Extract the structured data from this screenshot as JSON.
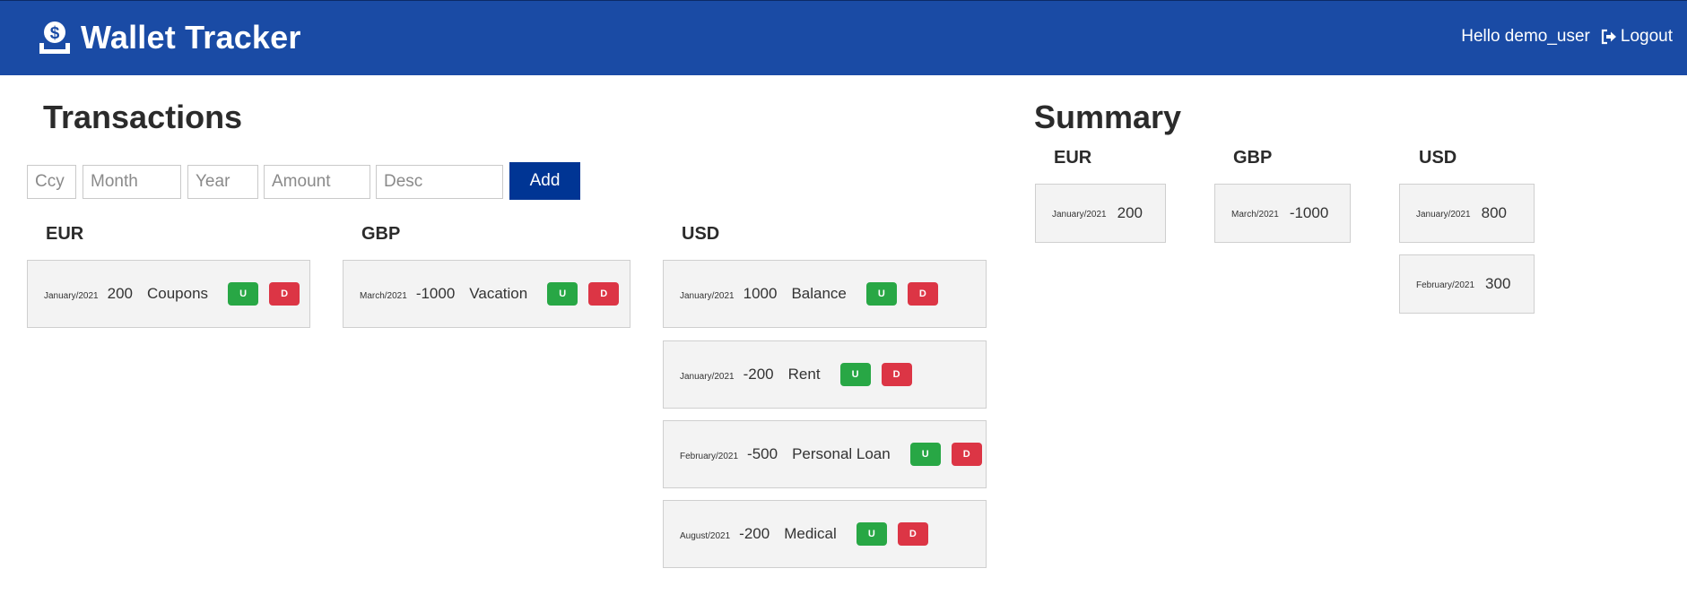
{
  "header": {
    "title": "Wallet Tracker",
    "greeting": "Hello demo_user",
    "logout_label": "Logout",
    "bg_color": "#1a4ba5"
  },
  "transactions": {
    "title": "Transactions",
    "form": {
      "ccy_placeholder": "Ccy",
      "month_placeholder": "Month",
      "year_placeholder": "Year",
      "amount_placeholder": "Amount",
      "desc_placeholder": "Desc",
      "add_label": "Add"
    },
    "columns": [
      {
        "currency": "EUR",
        "items": [
          {
            "date": "January/2021",
            "amount": "200",
            "desc": "Coupons",
            "update": "U",
            "delete": "D"
          }
        ]
      },
      {
        "currency": "GBP",
        "items": [
          {
            "date": "March/2021",
            "amount": "-1000",
            "desc": "Vacation",
            "update": "U",
            "delete": "D"
          }
        ]
      },
      {
        "currency": "USD",
        "items": [
          {
            "date": "January/2021",
            "amount": "1000",
            "desc": "Balance",
            "update": "U",
            "delete": "D"
          },
          {
            "date": "January/2021",
            "amount": "-200",
            "desc": "Rent",
            "update": "U",
            "delete": "D"
          },
          {
            "date": "February/2021",
            "amount": "-500",
            "desc": "Personal Loan",
            "update": "U",
            "delete": "D"
          },
          {
            "date": "August/2021",
            "amount": "-200",
            "desc": "Medical",
            "update": "U",
            "delete": "D"
          }
        ]
      }
    ]
  },
  "summary": {
    "title": "Summary",
    "columns": [
      {
        "currency": "EUR",
        "items": [
          {
            "date": "January/2021",
            "amount": "200"
          }
        ]
      },
      {
        "currency": "GBP",
        "items": [
          {
            "date": "March/2021",
            "amount": "-1000"
          }
        ]
      },
      {
        "currency": "USD",
        "items": [
          {
            "date": "January/2021",
            "amount": "800"
          },
          {
            "date": "February/2021",
            "amount": "300"
          }
        ]
      }
    ]
  },
  "colors": {
    "update_button": "#28a745",
    "delete_button": "#dc3545",
    "add_button": "#003594"
  }
}
